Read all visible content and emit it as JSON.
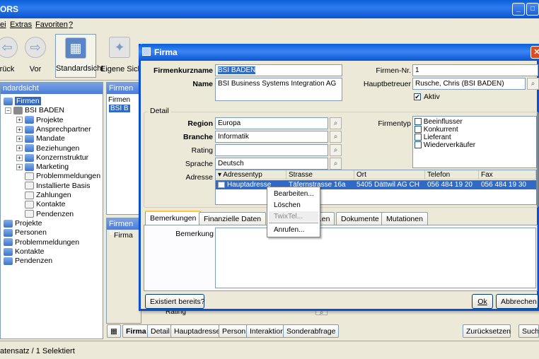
{
  "main_window": {
    "title": "ORS",
    "title_buttons": [
      "_",
      "□"
    ]
  },
  "menu": [
    "ei",
    "Extras",
    "Favoriten",
    "?"
  ],
  "toolbar": {
    "buttons": [
      {
        "label": "rück",
        "icon": "back-arrow-icon",
        "glyph": "⇦"
      },
      {
        "label": "Vor",
        "icon": "forward-arrow-icon",
        "glyph": "⇨"
      },
      {
        "label": "Standardsicht",
        "icon": "standard-view-icon",
        "glyph": "▦"
      },
      {
        "label": "Eigene Sicht",
        "icon": "custom-view-icon",
        "glyph": "✦"
      }
    ]
  },
  "left_panel": {
    "header": "ndardsicht",
    "tree": [
      {
        "label": "Firmen",
        "icon": "folder",
        "selected": true
      },
      {
        "label": "BSI BADEN",
        "icon": "building"
      },
      {
        "label": "Projekte",
        "icon": "folder"
      },
      {
        "label": "Ansprechpartner",
        "icon": "folder"
      },
      {
        "label": "Mandate",
        "icon": "folder"
      },
      {
        "label": "Beziehungen",
        "icon": "folder"
      },
      {
        "label": "Konzernstruktur",
        "icon": "folder"
      },
      {
        "label": "Marketing",
        "icon": "folder"
      },
      {
        "label": "Problemmeldungen",
        "icon": "doc"
      },
      {
        "label": "Installierte Basis",
        "icon": "doc"
      },
      {
        "label": "Zahlungen",
        "icon": "doc"
      },
      {
        "label": "Kontakte",
        "icon": "doc"
      },
      {
        "label": "Pendenzen",
        "icon": "doc"
      },
      {
        "label": "Projekte",
        "icon": "folder"
      },
      {
        "label": "Personen",
        "icon": "folder"
      },
      {
        "label": "Problemmeldungen",
        "icon": "folder"
      },
      {
        "label": "Kontakte",
        "icon": "folder"
      },
      {
        "label": "Pendenzen",
        "icon": "folder"
      }
    ]
  },
  "middle_panel": {
    "header": "Firmen",
    "column": "Firmen",
    "row": "BSI B",
    "search_header": "Firmen suc",
    "search_label": "Firma",
    "rating_label": "Rating"
  },
  "bottom_bar": {
    "buttons": [
      "Firma",
      "Detail",
      "Hauptadresse",
      "Person",
      "Interaktion",
      "Sonderabfrage",
      "Zurücksetzen",
      "Suche"
    ]
  },
  "statusbar": "atensatz / 1 Selektiert",
  "dialog": {
    "title": "Firma",
    "labels": {
      "kurzname": "Firmenkurzname",
      "name": "Name",
      "firmen_nr": "Firmen-Nr.",
      "hauptbetreuer": "Hauptbetreuer",
      "aktiv": "Aktiv",
      "detail_group": "Detail",
      "region": "Region",
      "branche": "Branche",
      "rating": "Rating",
      "sprache": "Sprache",
      "adresse": "Adresse",
      "firmentyp": "Firmentyp"
    },
    "values": {
      "kurzname": "BSI BADEN",
      "name": "BSI Business Systems Integration AG",
      "firmen_nr": "1",
      "hauptbetreuer": "Rusche, Chris (BSI BADEN)",
      "aktiv": true,
      "region": "Europa",
      "branche": "Informatik",
      "rating": "",
      "sprache": "Deutsch"
    },
    "firmentyp": [
      "Beeinflusser",
      "Konkurrent",
      "Lieferant",
      "Wiederverkäufer"
    ],
    "address_table": {
      "columns": [
        "Adressentyp",
        "Strasse",
        "Ort",
        "Telefon",
        "Fax"
      ],
      "rows": [
        [
          "Hauptadresse",
          "Täfernstrasse 16a",
          "5405 Dättwil AG CH",
          "056 484 19 20",
          "056 484 19 30"
        ]
      ]
    },
    "context_menu": [
      "Bearbeiten...",
      "Löschen",
      "TwixTel...",
      "Anrufen..."
    ],
    "tabs": [
      "Bemerkungen",
      "Finanzielle Daten",
      "...en",
      "Dokumente",
      "Mutationen"
    ],
    "bemerkung_label": "Bemerkung",
    "buttons": {
      "exists": "Existiert bereits?",
      "ok": "Ok",
      "cancel": "Abbrechen"
    }
  },
  "colors": {
    "titlebar": "#0A5FD9",
    "selection": "#316AC5",
    "window_bg": "#ECE9D8",
    "close": "#E04A1F"
  }
}
